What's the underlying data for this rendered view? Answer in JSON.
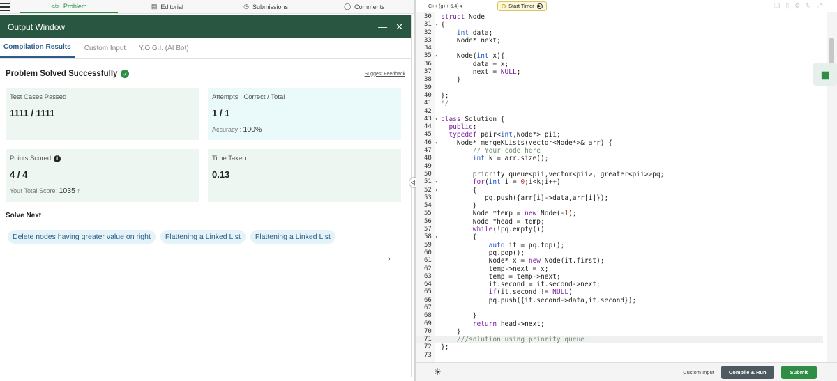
{
  "nav": {
    "tabs": [
      {
        "label": "Problem",
        "icon": "code-icon"
      },
      {
        "label": "Editorial",
        "icon": "document-icon"
      },
      {
        "label": "Submissions",
        "icon": "clock-icon"
      },
      {
        "label": "Comments",
        "icon": "comment-icon"
      }
    ]
  },
  "output": {
    "title": "Output Window",
    "tabs": [
      "Compilation Results",
      "Custom Input",
      "Y.O.G.I. (AI Bot)"
    ],
    "status": "Problem Solved Successfully",
    "feedback_link": "Suggest Feedback",
    "cards": {
      "test_cases": {
        "label": "Test Cases Passed",
        "value": "1111 / 1111"
      },
      "attempts": {
        "label": "Attempts : Correct / Total",
        "value": "1 / 1",
        "sub_label": "Accuracy :",
        "sub_value": "100%"
      },
      "points": {
        "label": "Points Scored",
        "value": "4 / 4",
        "sub_label": "Your Total Score:",
        "sub_value": "1035"
      },
      "time": {
        "label": "Time Taken",
        "value": "0.13"
      }
    },
    "solve_next": {
      "heading": "Solve Next",
      "items": [
        "Delete nodes having greater value on right",
        "Flattening a Linked List",
        "Flattening a Linked List"
      ]
    }
  },
  "editor": {
    "language": "C++ (g++ 5.4)",
    "timer_label": "Start Timer",
    "bottom": {
      "custom_input": "Custom Input",
      "compile_run": "Compile & Run",
      "submit": "Submit"
    },
    "lines": [
      {
        "n": "30",
        "fold": false,
        "text": "struct Node"
      },
      {
        "n": "31",
        "fold": true,
        "text": "{"
      },
      {
        "n": "32",
        "fold": false,
        "text": "    int data;"
      },
      {
        "n": "33",
        "fold": false,
        "text": "    Node* next;"
      },
      {
        "n": "34",
        "fold": false,
        "text": ""
      },
      {
        "n": "35",
        "fold": true,
        "text": "    Node(int x){"
      },
      {
        "n": "36",
        "fold": false,
        "text": "        data = x;"
      },
      {
        "n": "37",
        "fold": false,
        "text": "        next = NULL;"
      },
      {
        "n": "38",
        "fold": false,
        "text": "    }"
      },
      {
        "n": "39",
        "fold": false,
        "text": ""
      },
      {
        "n": "40",
        "fold": false,
        "text": "};"
      },
      {
        "n": "41",
        "fold": false,
        "text": "*/"
      },
      {
        "n": "42",
        "fold": false,
        "text": ""
      },
      {
        "n": "43",
        "fold": true,
        "text": "class Solution {"
      },
      {
        "n": "44",
        "fold": false,
        "text": "  public:"
      },
      {
        "n": "45",
        "fold": false,
        "text": "  typedef pair<int,Node*> pii;"
      },
      {
        "n": "46",
        "fold": true,
        "text": "    Node* mergeKLists(vector<Node*>& arr) {"
      },
      {
        "n": "47",
        "fold": false,
        "text": "        // Your code here"
      },
      {
        "n": "48",
        "fold": false,
        "text": "        int k = arr.size();"
      },
      {
        "n": "49",
        "fold": false,
        "text": ""
      },
      {
        "n": "50",
        "fold": false,
        "text": "        priority_queue<pii,vector<pii>, greater<pii>>pq;"
      },
      {
        "n": "51",
        "fold": true,
        "text": "        for(int i = 0;i<k;i++)"
      },
      {
        "n": "52",
        "fold": true,
        "text": "        {"
      },
      {
        "n": "53",
        "fold": false,
        "text": "           pq.push({arr[i]->data,arr[i]});"
      },
      {
        "n": "54",
        "fold": false,
        "text": "        }"
      },
      {
        "n": "55",
        "fold": false,
        "text": "        Node *temp = new Node(-1);"
      },
      {
        "n": "56",
        "fold": false,
        "text": "        Node *head = temp;"
      },
      {
        "n": "57",
        "fold": false,
        "text": "        while(!pq.empty())"
      },
      {
        "n": "58",
        "fold": true,
        "text": "        {"
      },
      {
        "n": "59",
        "fold": false,
        "text": "            auto it = pq.top();"
      },
      {
        "n": "60",
        "fold": false,
        "text": "            pq.pop();"
      },
      {
        "n": "61",
        "fold": false,
        "text": "            Node* x = new Node(it.first);"
      },
      {
        "n": "62",
        "fold": false,
        "text": "            temp->next = x;"
      },
      {
        "n": "63",
        "fold": false,
        "text": "            temp = temp->next;"
      },
      {
        "n": "64",
        "fold": false,
        "text": "            it.second = it.second->next;"
      },
      {
        "n": "65",
        "fold": false,
        "text": "            if(it.second != NULL)"
      },
      {
        "n": "66",
        "fold": false,
        "text": "            pq.push({it.second->data,it.second});"
      },
      {
        "n": "67",
        "fold": false,
        "text": ""
      },
      {
        "n": "68",
        "fold": false,
        "text": "        }"
      },
      {
        "n": "69",
        "fold": false,
        "text": "        return head->next;"
      },
      {
        "n": "70",
        "fold": false,
        "text": "    }"
      },
      {
        "n": "71",
        "fold": false,
        "text": "    ///solution using priority_queue"
      },
      {
        "n": "72",
        "fold": false,
        "text": "};"
      },
      {
        "n": "73",
        "fold": false,
        "text": ""
      }
    ],
    "highlighted_line": "71"
  },
  "colors": {
    "brand_green": "#2f8d46",
    "header_green": "#295640",
    "accent_blue": "#2c5d8a"
  }
}
